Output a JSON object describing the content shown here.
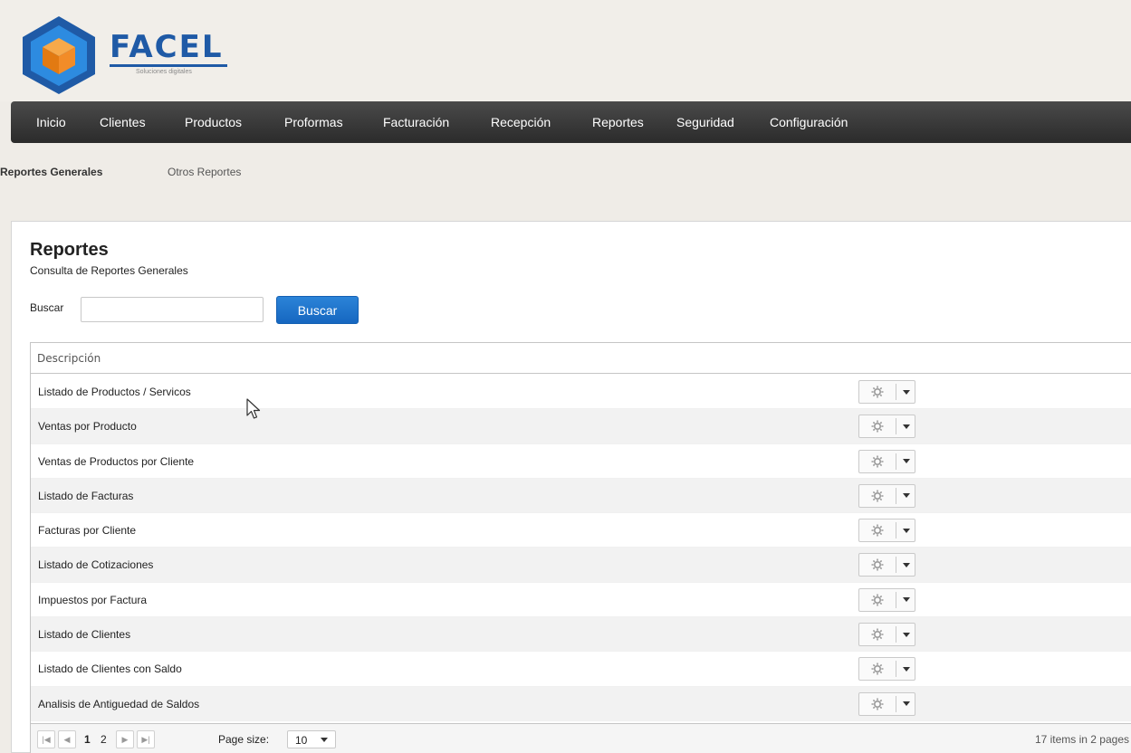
{
  "brand": {
    "name": "FACEL",
    "tagline": "Soluciones digitales",
    "colors": {
      "primary": "#1f5aa6",
      "accent": "#f28c28"
    }
  },
  "nav": {
    "items": [
      {
        "label": "Inicio"
      },
      {
        "label": "Clientes"
      },
      {
        "label": "Productos"
      },
      {
        "label": "Proformas"
      },
      {
        "label": "Facturación"
      },
      {
        "label": "Recepción"
      },
      {
        "label": "Reportes"
      },
      {
        "label": "Seguridad"
      },
      {
        "label": "Configuración"
      }
    ]
  },
  "submenu": {
    "items": [
      {
        "label": "Reportes Generales",
        "active": true
      },
      {
        "label": "Otros Reportes",
        "active": false
      }
    ]
  },
  "page": {
    "title": "Reportes",
    "subtitle": "Consulta de Reportes Generales"
  },
  "search": {
    "label": "Buscar",
    "value": "",
    "button_label": "Buscar",
    "button_color": "#1a6fca"
  },
  "grid": {
    "columns": [
      "Descripción"
    ],
    "rows": [
      {
        "description": "Listado de Productos / Servicos"
      },
      {
        "description": "Ventas por Producto"
      },
      {
        "description": "Ventas de Productos por Cliente"
      },
      {
        "description": "Listado de Facturas"
      },
      {
        "description": "Facturas por Cliente"
      },
      {
        "description": "Listado de Cotizaciones"
      },
      {
        "description": "Impuestos por Factura"
      },
      {
        "description": "Listado de Clientes"
      },
      {
        "description": "Listado de Clientes con Saldo"
      },
      {
        "description": "Analisis de Antiguedad de Saldos"
      }
    ],
    "row_action_icon": "gear-icon"
  },
  "pager": {
    "pages": [
      "1",
      "2"
    ],
    "current_page": "1",
    "page_size_label": "Page size:",
    "page_size": "10",
    "info": "17 items in 2 pages"
  }
}
